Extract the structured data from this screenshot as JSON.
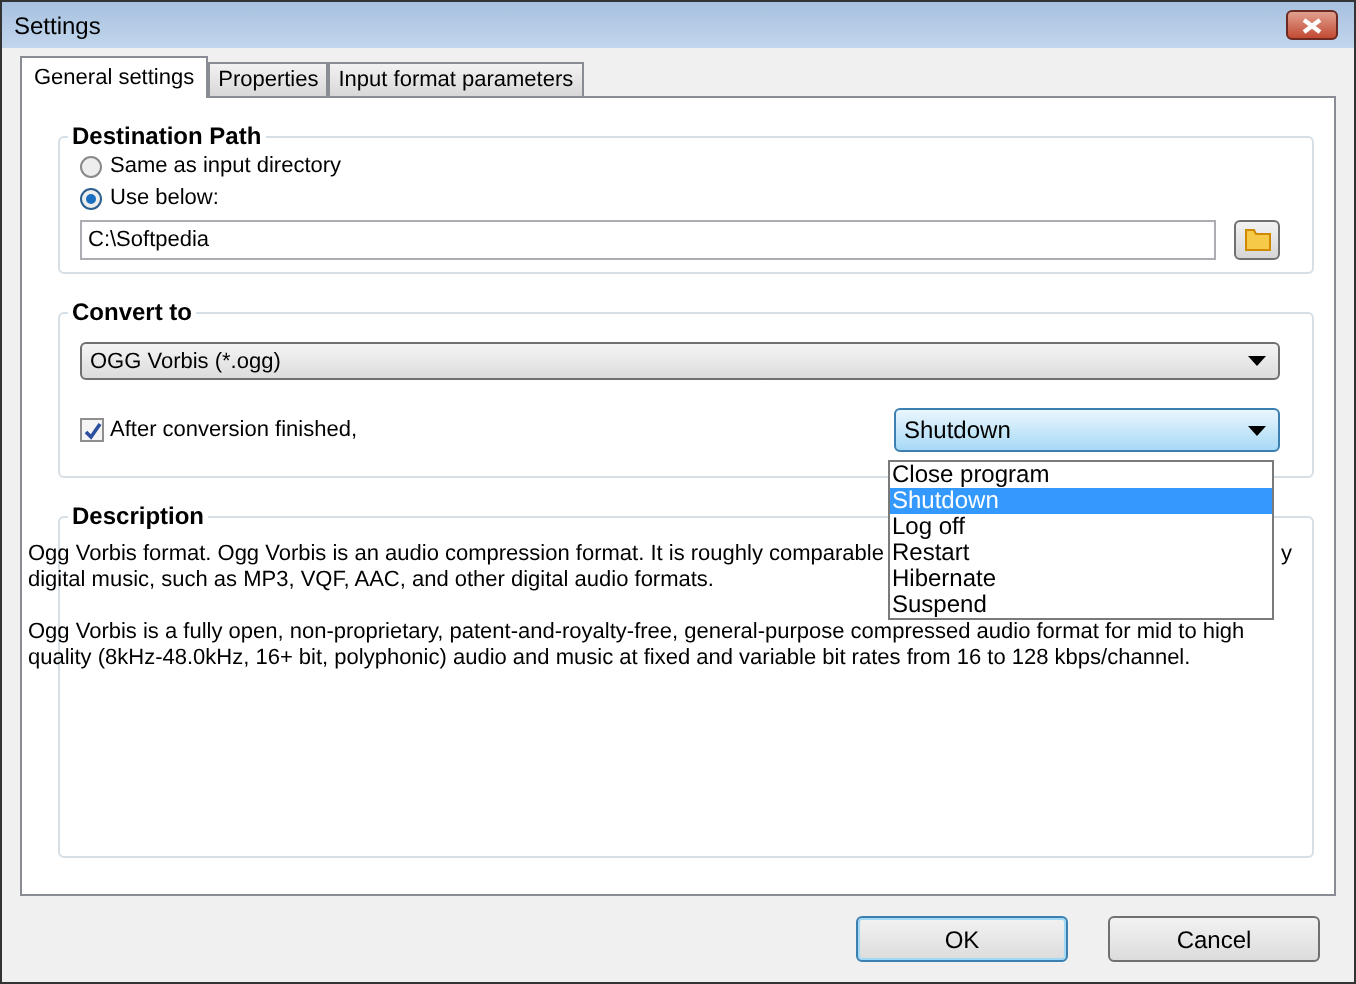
{
  "window": {
    "title": "Settings"
  },
  "tabs": [
    {
      "label": "General settings",
      "selected": true
    },
    {
      "label": "Properties",
      "selected": false
    },
    {
      "label": "Input format parameters",
      "selected": false
    }
  ],
  "destination": {
    "title": "Destination Path",
    "options": [
      {
        "label": "Same as input directory",
        "selected": false
      },
      {
        "label": "Use below:",
        "selected": true
      }
    ],
    "path": "C:\\Softpedia"
  },
  "convert": {
    "title": "Convert to",
    "format": "OGG Vorbis (*.ogg)",
    "after": {
      "label": "After conversion finished,",
      "checked": true
    },
    "action": "Shutdown",
    "action_options": [
      {
        "label": "Close program",
        "selected": false
      },
      {
        "label": "Shutdown",
        "selected": true
      },
      {
        "label": "Log off",
        "selected": false
      },
      {
        "label": "Restart",
        "selected": false
      },
      {
        "label": "Hibernate",
        "selected": false
      },
      {
        "label": "Suspend",
        "selected": false
      }
    ]
  },
  "description": {
    "title": "Description",
    "paragraphs": [
      {
        "lines": [
          [
            "Ogg Vorbis format. Ogg Vorbis is an audio compression format. It is roughly comparable",
            "y"
          ],
          [
            "digital music, such as MP3, VQF, AAC, and other digital audio formats."
          ]
        ]
      },
      {
        "lines": [
          [
            "Ogg Vorbis is a fully open, non-proprietary, patent-and-royalty-free, general-purpose compressed audio format for mid to high"
          ],
          [
            "quality (8kHz-48.0kHz, 16+ bit, polyphonic) audio and music at fixed and variable bit rates from 16 to 128 kbps/channel."
          ]
        ]
      }
    ]
  },
  "buttons": [
    {
      "label": "OK",
      "kind": "default"
    },
    {
      "label": "Cancel",
      "kind": "normal"
    }
  ]
}
